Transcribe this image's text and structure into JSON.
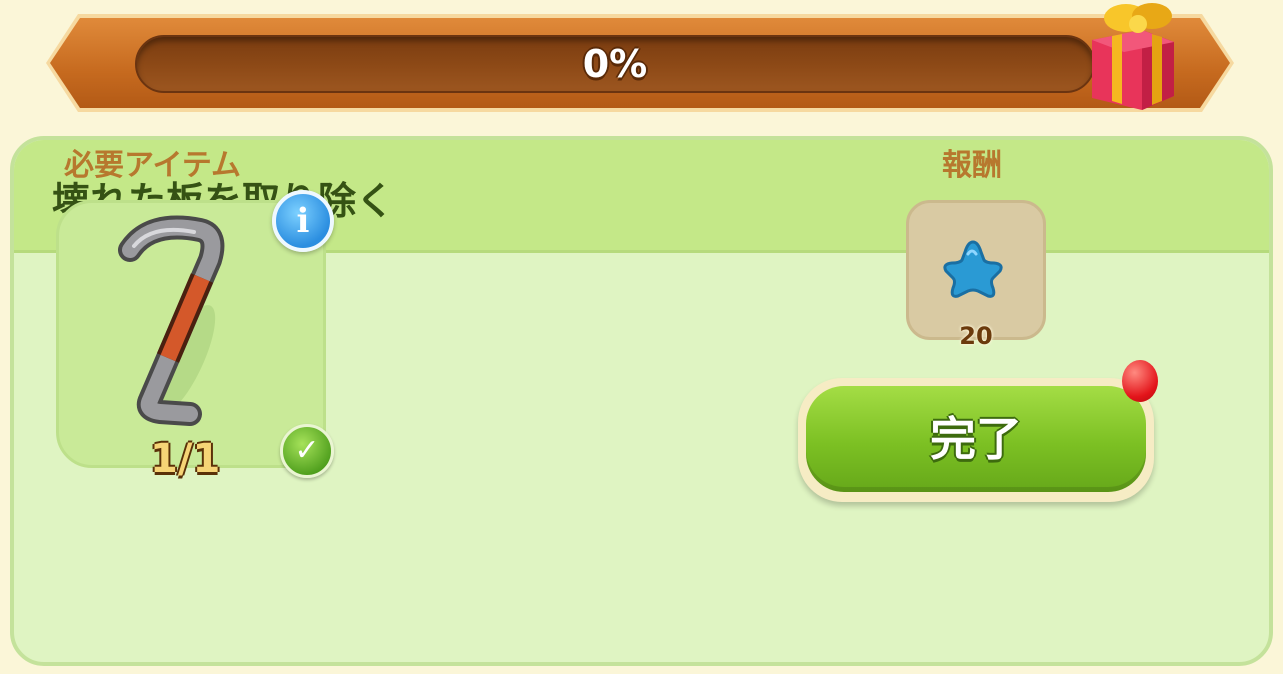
{
  "progress": {
    "label": "0%",
    "value": 0
  },
  "task": {
    "title": "壊れた板を取り除く"
  },
  "required": {
    "label": "必要アイテム",
    "item_icon": "crowbar-icon",
    "count": "1/1",
    "info_icon": "info-icon",
    "status_icon": "checkmark-icon"
  },
  "reward": {
    "label": "報酬",
    "icon": "blue-star-icon",
    "amount": "20"
  },
  "complete_button": {
    "label": "完了"
  },
  "colors": {
    "accent_green": "#7cc023",
    "frame_orange": "#c66a1f",
    "panel_green": "#dff4c2",
    "header_green": "#c4e888"
  }
}
